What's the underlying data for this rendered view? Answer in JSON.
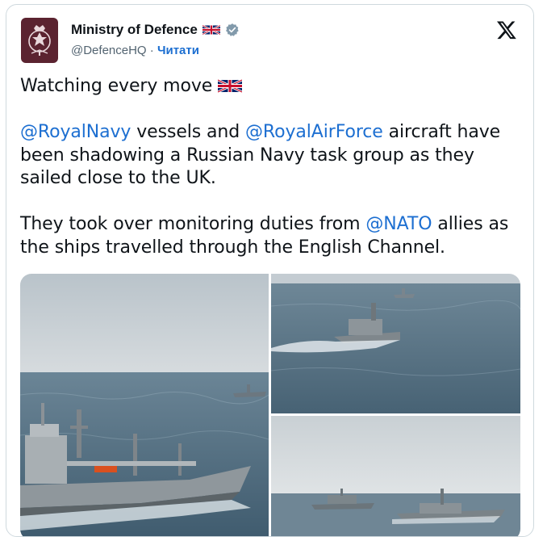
{
  "account": {
    "name": "Ministry of Defence",
    "handle": "@DefenceHQ",
    "separator": "·",
    "follow_label": "Читати",
    "verified_icon": "verified-badge-icon",
    "flag_icon": "uk-flag-icon"
  },
  "tweet": {
    "line1": "Watching every move",
    "para2": {
      "mention1": "@RoyalNavy",
      "text1": " vessels and ",
      "mention2": "@RoyalAirForce",
      "text2": " aircraft have been shadowing a Russian Navy task group as they sailed close to the UK."
    },
    "para3": {
      "text1": "They took over monitoring duties from ",
      "mention": "@NATO",
      "text2": " allies as the ships travelled through the English Channel."
    }
  },
  "media": {
    "photos": [
      "ship-photo-1",
      "ship-photo-2",
      "ship-photo-3"
    ]
  },
  "colors": {
    "link": "#1d6fd1",
    "text": "#0f1419",
    "secondary": "#536471",
    "border": "#cfd9de"
  }
}
